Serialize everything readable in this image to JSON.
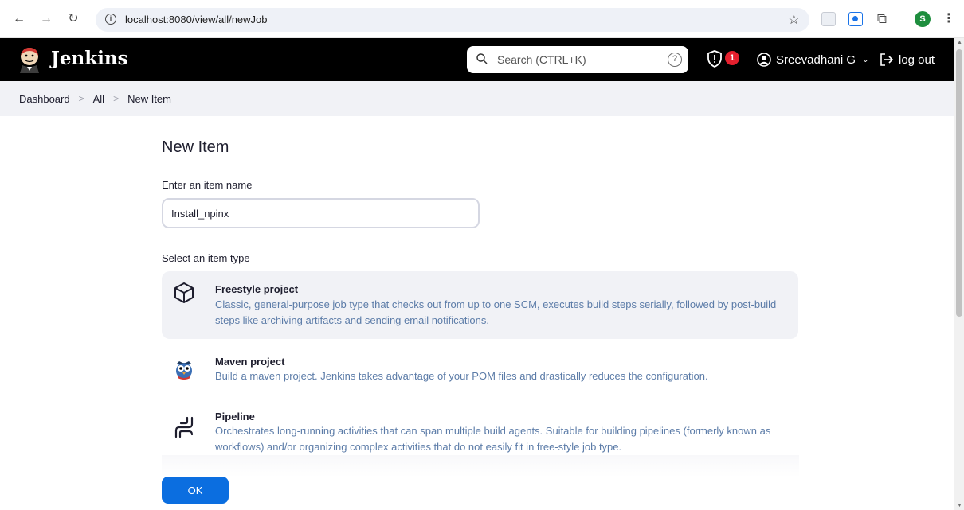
{
  "browser": {
    "url": "localhost:8080/view/all/newJob",
    "profile_initial": "S"
  },
  "header": {
    "brand": "Jenkins",
    "search_placeholder": "Search (CTRL+K)",
    "help_label": "?",
    "security_badge": "1",
    "user_name": "Sreevadhani G",
    "logout_label": "log out"
  },
  "breadcrumb": [
    "Dashboard",
    "All",
    "New Item"
  ],
  "main": {
    "title": "New Item",
    "name_label": "Enter an item name",
    "name_value": "Install_npinx",
    "type_label": "Select an item type",
    "items": [
      {
        "title": "Freestyle project",
        "description": "Classic, general-purpose job type that checks out from up to one SCM, executes build steps serially, followed by post-build steps like archiving artifacts and sending email notifications.",
        "icon": "cube-icon"
      },
      {
        "title": "Maven project",
        "description": "Build a maven project. Jenkins takes advantage of your POM files and drastically reduces the configuration.",
        "icon": "maven-owl-icon"
      },
      {
        "title": "Pipeline",
        "description": "Orchestrates long-running activities that can span multiple build agents. Suitable for building pipelines (formerly known as workflows) and/or organizing complex activities that do not easily fit in free-style job type.",
        "icon": "pipeline-icon"
      }
    ],
    "ok_label": "OK"
  },
  "colors": {
    "header_bg": "#000000",
    "accent": "#0b6ee0",
    "badge": "#e5202e",
    "desc_text": "#5c7ca8",
    "selected_bg": "#f1f2f6"
  }
}
